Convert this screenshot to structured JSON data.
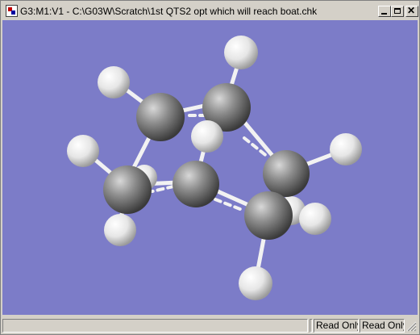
{
  "window": {
    "title": "G3:M1:V1 - C:\\G03W\\Scratch\\1st QTS2 opt which will reach boat.chk",
    "icon": "gaussview-app-icon",
    "controls": {
      "minimize_glyph": "_",
      "maximize_glyph": "□",
      "close_glyph": "X"
    }
  },
  "viewport": {
    "background": "#7c7cc8",
    "content": "3D ball-and-stick molecule: 6 carbon atoms, 10 hydrogen atoms",
    "carbon_color": "#8a8a8a",
    "hydrogen_color": "#e8e8e8",
    "bond_color": "#f0f0f0"
  },
  "statusbar": {
    "message": "",
    "status_1": "Read Only",
    "status_2": "Read Only"
  }
}
